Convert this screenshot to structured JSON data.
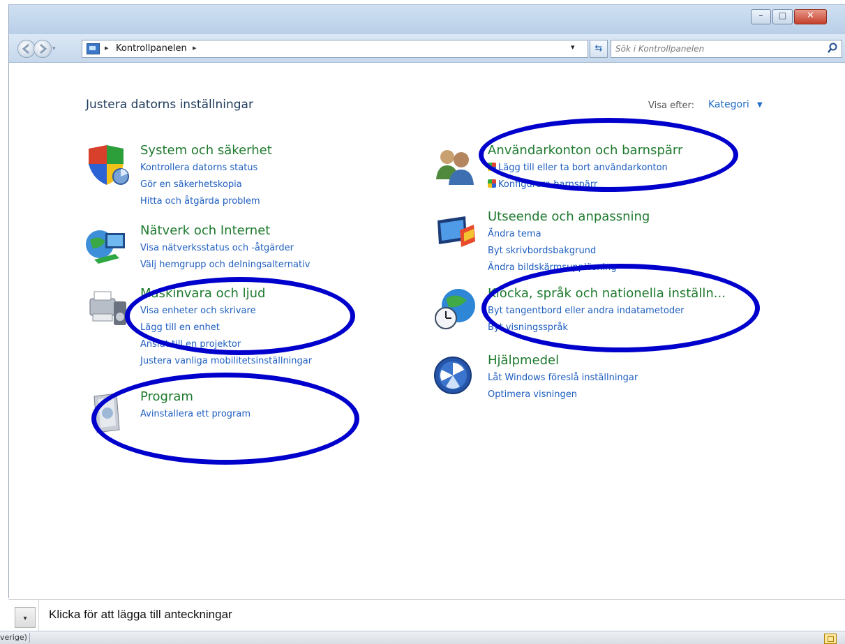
{
  "window": {
    "minimize_glyph": "–",
    "maximize_glyph": "□",
    "close_glyph": "✕"
  },
  "address": {
    "breadcrumb": "Kontrollpanelen",
    "arrow": "▸",
    "dropdown_glyph": "▾",
    "refresh_glyph": "⇆",
    "search_placeholder": "Sök i Kontrollpanelen"
  },
  "header": {
    "title": "Justera datorns inställningar",
    "view_by_label": "Visa efter:",
    "view_by_value": "Kategori",
    "view_by_caret": "▼"
  },
  "categories": [
    {
      "title": "System och säkerhet",
      "icon": "security-shield-icon",
      "links": [
        "Kontrollera datorns status",
        "Gör en säkerhetskopia",
        "Hitta och åtgärda problem"
      ]
    },
    {
      "title": "Nätverk och Internet",
      "icon": "network-globe-icon",
      "links": [
        "Visa nätverksstatus och -åtgärder",
        "Välj hemgrupp och delningsalternativ"
      ]
    },
    {
      "title": "Maskinvara och ljud",
      "icon": "printer-hardware-icon",
      "links": [
        "Visa enheter och skrivare",
        "Lägg till en enhet",
        "Anslut till en projektor",
        "Justera vanliga mobilitetsinställningar"
      ]
    },
    {
      "title": "Program",
      "icon": "programs-box-icon",
      "links": [
        "Avinstallera ett program"
      ]
    },
    {
      "title": "Användarkonton och barnspärr",
      "icon": "users-icon",
      "links": [
        "Lägg till eller ta bort användarkonton",
        "Konfigurera barnspärr"
      ]
    },
    {
      "title": "Utseende och anpassning",
      "icon": "appearance-monitor-icon",
      "links": [
        "Ändra tema",
        "Byt skrivbordsbakgrund",
        "Ändra bildskärmsupplösning"
      ]
    },
    {
      "title": "Klocka, språk och nationella inställn...",
      "icon": "clock-globe-icon",
      "links": [
        "Byt tangentbord eller andra indatametoder",
        "Byt visningsspråk"
      ]
    },
    {
      "title": "Hjälpmedel",
      "icon": "accessibility-icon",
      "links": [
        "Låt Windows föreslå inställningar",
        "Optimera visningen"
      ]
    }
  ],
  "notes": {
    "toggle_glyph": "▾",
    "text": "Klicka för att lägga till anteckningar"
  },
  "statusbar": {
    "text": "verige)"
  },
  "colors": {
    "category_title": "#1e7a2e",
    "link": "#1e5ec0",
    "annotation_ellipse": "#0000cc"
  }
}
